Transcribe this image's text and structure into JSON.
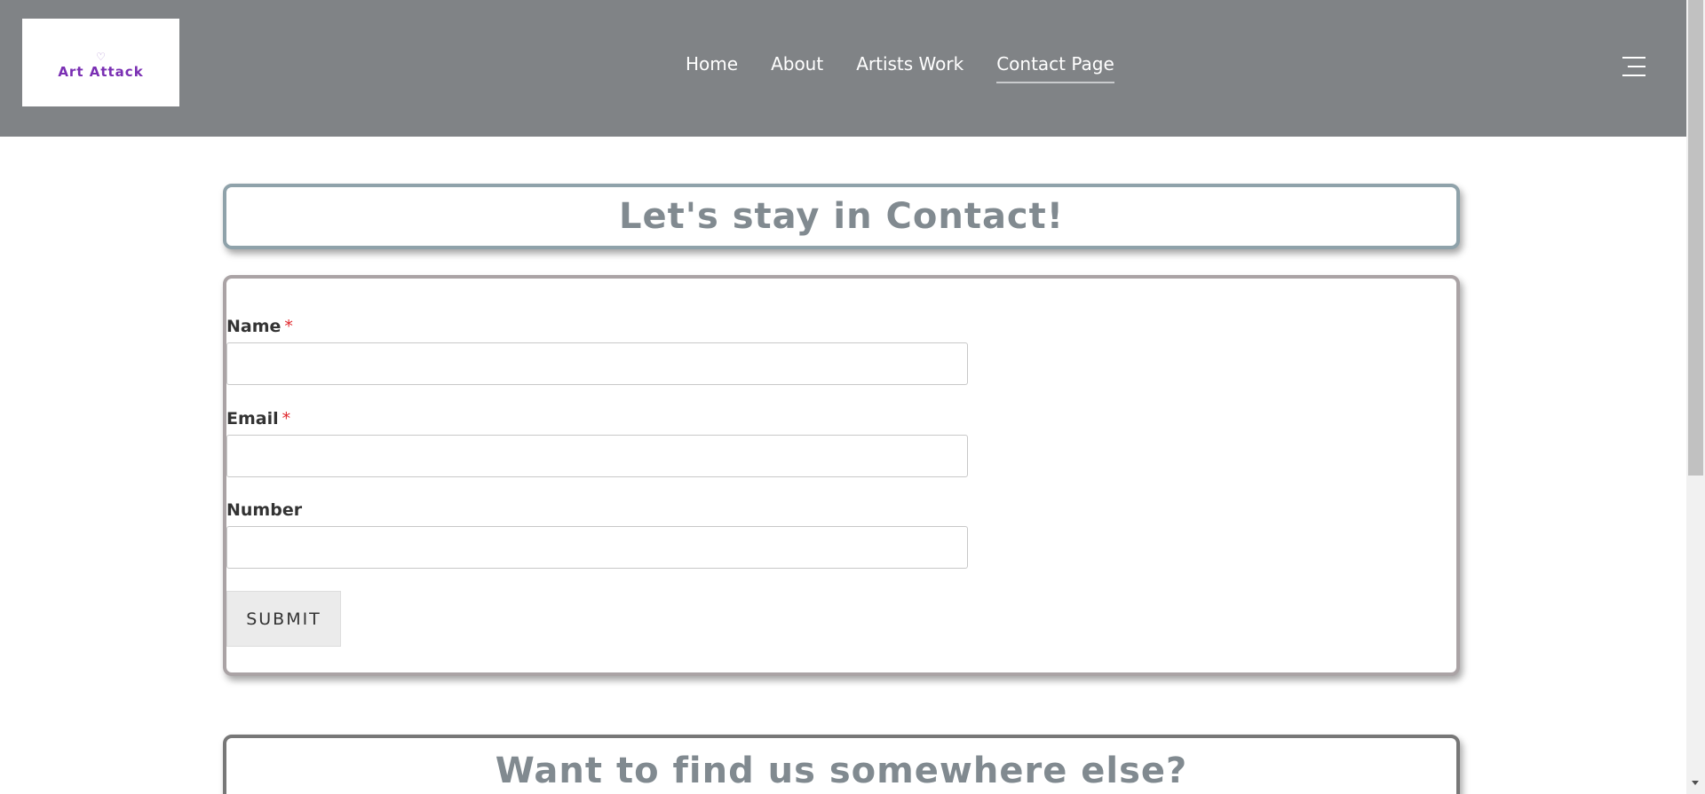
{
  "header": {
    "logo_text": "Art Attack",
    "nav": [
      {
        "label": "Home"
      },
      {
        "label": "About"
      },
      {
        "label": "Artists Work"
      },
      {
        "label": "Contact Page"
      }
    ]
  },
  "contact_title": "Let's stay in Contact!",
  "form": {
    "fields": [
      {
        "label": "Name",
        "required_mark": "*",
        "value": ""
      },
      {
        "label": "Email",
        "required_mark": "*",
        "value": ""
      },
      {
        "label": "Number",
        "value": ""
      }
    ],
    "submit_label": "SUBMIT"
  },
  "elsewhere_title": "Want to find us somewhere else?",
  "colors": {
    "header_bg": "#808386",
    "title_text": "#818a90",
    "required": "#e0272c",
    "logo_text": "#7a2fb3"
  },
  "icons": {
    "menu": "hamburger-icon",
    "logo": "heart-icon"
  }
}
